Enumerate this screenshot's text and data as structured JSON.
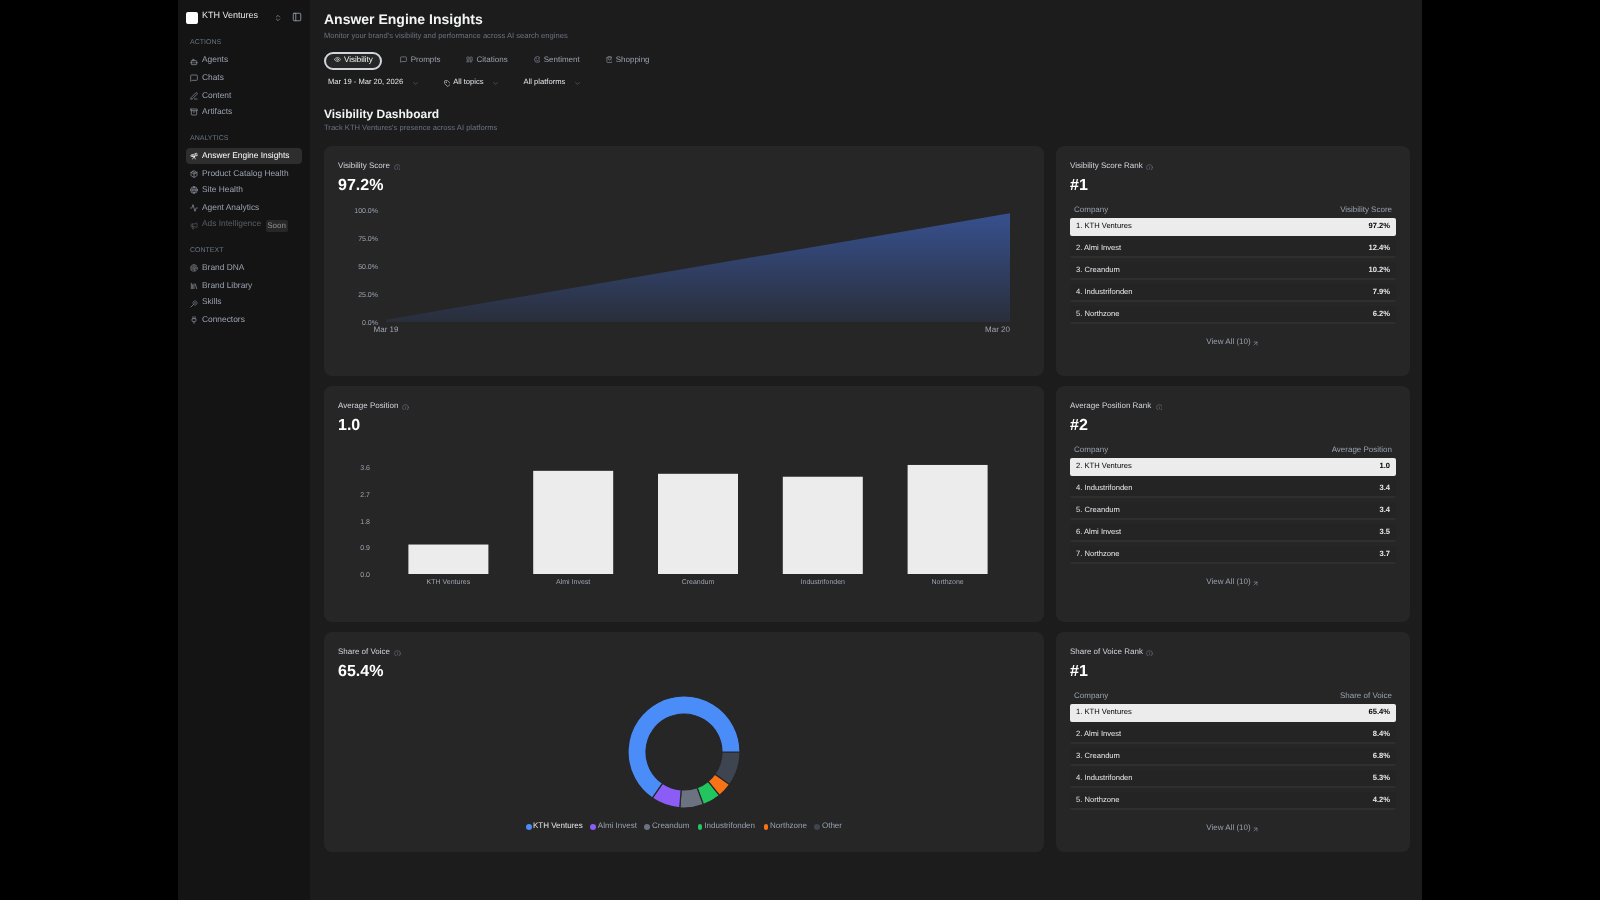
{
  "sidebar": {
    "workspace": "KTH Ventures",
    "sections": [
      {
        "heading": "ACTIONS",
        "items": [
          {
            "label": "Agents",
            "selected": false,
            "disabled": false
          },
          {
            "label": "Chats",
            "selected": false,
            "disabled": false
          },
          {
            "label": "Content",
            "selected": false,
            "disabled": false
          },
          {
            "label": "Artifacts",
            "selected": false,
            "disabled": false
          }
        ]
      },
      {
        "heading": "ANALYTICS",
        "items": [
          {
            "label": "Answer Engine Insights",
            "selected": true,
            "disabled": false
          },
          {
            "label": "Product Catalog Health",
            "selected": false,
            "disabled": false
          },
          {
            "label": "Site Health",
            "selected": false,
            "disabled": false
          },
          {
            "label": "Agent Analytics",
            "selected": false,
            "disabled": false
          },
          {
            "label": "Ads Intelligence",
            "selected": false,
            "disabled": true,
            "badge": "Soon"
          }
        ]
      },
      {
        "heading": "CONTEXT",
        "items": [
          {
            "label": "Brand DNA",
            "selected": false,
            "disabled": false
          },
          {
            "label": "Brand Library",
            "selected": false,
            "disabled": false
          },
          {
            "label": "Skills",
            "selected": false,
            "disabled": false
          },
          {
            "label": "Connectors",
            "selected": false,
            "disabled": false
          }
        ]
      }
    ]
  },
  "header": {
    "title": "Answer Engine Insights",
    "subtitle": "Monitor your brand's visibility and performance across AI search engines"
  },
  "tabs": [
    {
      "label": "Visibility",
      "selected": true
    },
    {
      "label": "Prompts",
      "selected": false
    },
    {
      "label": "Citations",
      "selected": false
    },
    {
      "label": "Sentiment",
      "selected": false
    },
    {
      "label": "Shopping",
      "selected": false
    }
  ],
  "filters": [
    "Mar 19 - Mar 20, 2026",
    "All topics",
    "All platforms"
  ],
  "dashboard": {
    "title": "Visibility Dashboard",
    "subtitle": "Track KTH Ventures's presence across AI platforms"
  },
  "visibility_card": {
    "title": "Visibility Score",
    "value": "97.2%",
    "chart_data": {
      "type": "area",
      "x": [
        "Mar 19",
        "Mar 20"
      ],
      "ylim": [
        0,
        100
      ],
      "yticks": [
        {
          "value": 0,
          "label": "0.0%"
        },
        {
          "value": 25,
          "label": "25.0%"
        },
        {
          "value": 50,
          "label": "50.0%"
        },
        {
          "value": 75,
          "label": "75.0%"
        },
        {
          "value": 100,
          "label": "100.0%"
        }
      ],
      "series": [
        {
          "color": "#3b5ba9",
          "values": [
            2,
            97
          ]
        }
      ]
    }
  },
  "visibility_rank": {
    "title": "Visibility Score Rank",
    "rank": "#1",
    "columns": [
      "Company",
      "Visibility Score"
    ],
    "rows": [
      {
        "company": "1. KTH Ventures",
        "value": "97.2%",
        "highlighted": true
      },
      {
        "company": "2. Almi Invest",
        "value": "12.4%",
        "highlighted": false
      },
      {
        "company": "3. Creandum",
        "value": "10.2%",
        "highlighted": false
      },
      {
        "company": "4. Industrifonden",
        "value": "7.9%",
        "highlighted": false
      },
      {
        "company": "5. Northzone",
        "value": "6.2%",
        "highlighted": false
      }
    ],
    "link": "View All (10)"
  },
  "position_card": {
    "title": "Average Position",
    "value": "1.0",
    "chart_data": {
      "type": "bar",
      "categories": [
        "KTH Ventures",
        "Almi Invest",
        "Creandum",
        "Industrifonden",
        "Northzone"
      ],
      "ylim": [
        0,
        3.8
      ],
      "yticks": [
        {
          "value": 0,
          "label": "0.0"
        },
        {
          "value": 0.9,
          "label": "0.9"
        },
        {
          "value": 1.8,
          "label": "1.8"
        },
        {
          "value": 2.7,
          "label": "2.7"
        },
        {
          "value": 3.6,
          "label": "3.6"
        }
      ],
      "series": [
        {
          "color": "#ececec",
          "values": [
            1.0,
            3.5,
            3.4,
            3.3,
            3.7
          ]
        }
      ]
    }
  },
  "position_rank": {
    "title": "Average Position Rank",
    "rank": "#2",
    "columns": [
      "Company",
      "Average Position"
    ],
    "rows": [
      {
        "company": "2. KTH Ventures",
        "value": "1.0",
        "highlighted": true
      },
      {
        "company": "4. Industrifonden",
        "value": "3.4",
        "highlighted": false
      },
      {
        "company": "5. Creandum",
        "value": "3.4",
        "highlighted": false
      },
      {
        "company": "6. Almi Invest",
        "value": "3.5",
        "highlighted": false
      },
      {
        "company": "7. Northzone",
        "value": "3.7",
        "highlighted": false
      }
    ],
    "link": "View All (10)"
  },
  "voice_card": {
    "title": "Share of Voice",
    "value": "65.4%",
    "chart_data": {
      "type": "donut",
      "categories": [
        "KTH Ventures",
        "Almi Invest",
        "Creandum",
        "Industrifonden",
        "Northzone",
        "Other"
      ],
      "series": [
        {
          "values": [
            65.4,
            8.4,
            6.8,
            5.3,
            4.2,
            9.9
          ]
        }
      ],
      "legend": "bottom",
      "colors": [
        "#4b8df8",
        "#8b5cf6",
        "#6b7280",
        "#22c55e",
        "#f97316",
        "#3f4451"
      ]
    }
  },
  "voice_rank": {
    "title": "Share of Voice Rank",
    "rank": "#1",
    "columns": [
      "Company",
      "Share of Voice"
    ],
    "rows": [
      {
        "company": "1. KTH Ventures",
        "value": "65.4%",
        "highlighted": true
      },
      {
        "company": "2. Almi Invest",
        "value": "8.4%",
        "highlighted": false
      },
      {
        "company": "3. Creandum",
        "value": "6.8%",
        "highlighted": false
      },
      {
        "company": "4. Industrifonden",
        "value": "5.3%",
        "highlighted": false
      },
      {
        "company": "5. Northzone",
        "value": "4.2%",
        "highlighted": false
      }
    ],
    "link": "View All (10)"
  }
}
